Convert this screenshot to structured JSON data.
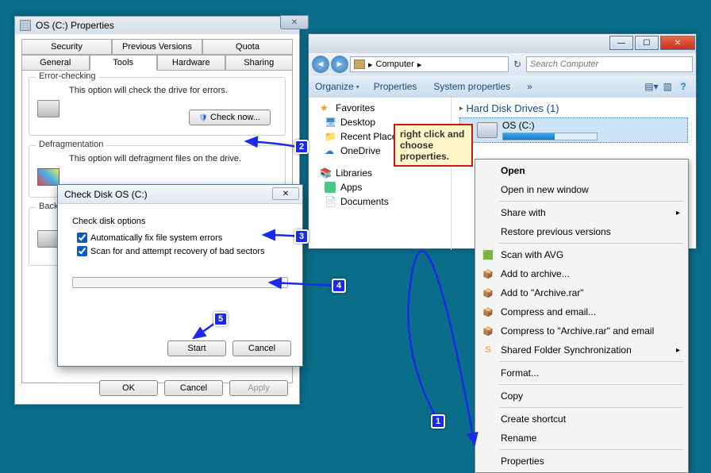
{
  "propWin": {
    "title": "OS (C:) Properties",
    "tabsRow1": [
      "Security",
      "Previous Versions",
      "Quota"
    ],
    "tabsRow2": [
      "General",
      "Tools",
      "Hardware",
      "Sharing"
    ],
    "activeTab": "Tools",
    "errorCheck": {
      "title": "Error-checking",
      "text": "This option will check the drive for errors.",
      "btn": "Check now..."
    },
    "defrag": {
      "title": "Defragmentation",
      "text": "This option will defragment files on the drive."
    },
    "backup": {
      "title": "Backup"
    },
    "footer": {
      "ok": "OK",
      "cancel": "Cancel",
      "apply": "Apply"
    }
  },
  "chkdsk": {
    "title": "Check Disk OS (C:)",
    "optionsLabel": "Check disk options",
    "opt1": "Automatically fix file system errors",
    "opt2": "Scan for and attempt recovery of bad sectors",
    "start": "Start",
    "cancel": "Cancel"
  },
  "explorer": {
    "breadcrumb": "Computer",
    "bcArrow": "▸",
    "searchPlaceholder": "Search Computer",
    "toolbar": {
      "organize": "Organize",
      "properties": "Properties",
      "sysprops": "System properties",
      "more": "»"
    },
    "sidebar": {
      "favorites": "Favorites",
      "desktop": "Desktop",
      "recent": "Recent Places",
      "onedrive": "OneDrive",
      "libraries": "Libraries",
      "apps": "Apps",
      "documents": "Documents"
    },
    "section": "Hard Disk Drives (1)",
    "drive": "OS (C:)"
  },
  "ctx": {
    "open": "Open",
    "openNew": "Open in new window",
    "shareWith": "Share with",
    "restore": "Restore previous versions",
    "scanAvg": "Scan with AVG",
    "addArchive": "Add to archive...",
    "addArchiveRar": "Add to \"Archive.rar\"",
    "compressEmail": "Compress and email...",
    "compressRarEmail": "Compress to \"Archive.rar\" and email",
    "sharedFolder": "Shared Folder Synchronization",
    "format": "Format...",
    "copy": "Copy",
    "createShortcut": "Create shortcut",
    "rename": "Rename",
    "properties": "Properties"
  },
  "annotation": "right click and choose properties.",
  "steps": {
    "s1": "1",
    "s2": "2",
    "s3": "3",
    "s4": "4",
    "s5": "5"
  }
}
